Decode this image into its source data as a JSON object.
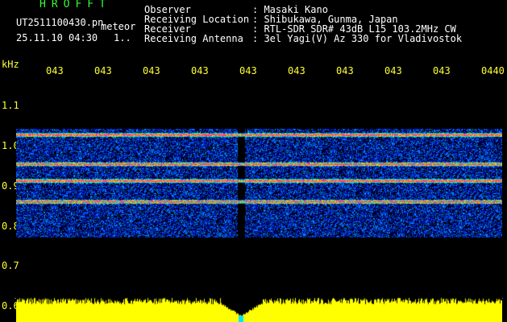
{
  "app": {
    "name": "HROFFT"
  },
  "file": {
    "name": "UT2511100430.pn",
    "suffix": "meteor",
    "datetime": "25.11.10 04:30",
    "page": "1.."
  },
  "info": {
    "labels": [
      "Observer",
      "Receiving Location",
      "Receiver",
      "Receiving Antenna"
    ],
    "values": [
      ": Masaki Kano",
      ": Shibukawa, Gunma, Japan",
      ": RTL-SDR SDR# 43dB L15 103.2MHz CW",
      ": 3el Yagi(V) Az 330 for Vladivostok"
    ]
  },
  "axes": {
    "y_unit": "kHz",
    "y_ticks": [
      "1.1",
      "1.0",
      "0.9",
      "0.8",
      "0.7",
      "0.6"
    ],
    "x_ticks": [
      "043",
      "043",
      "043",
      "043",
      "043",
      "043",
      "043",
      "043",
      "043",
      "0440"
    ]
  },
  "colors": {
    "background": "#000000",
    "text": "#ffffff",
    "axis_text": "#ffff33",
    "title": "#33ff33",
    "amplitude": "#ffff00",
    "marker": "#00e5ff"
  },
  "spectrogram": {
    "frequency_range_khz": [
      0.77,
      1.03
    ],
    "strong_lines_khz": [
      0.86,
      0.91,
      0.95,
      1.02
    ],
    "gap_time_fraction": [
      0.455,
      0.47
    ]
  }
}
